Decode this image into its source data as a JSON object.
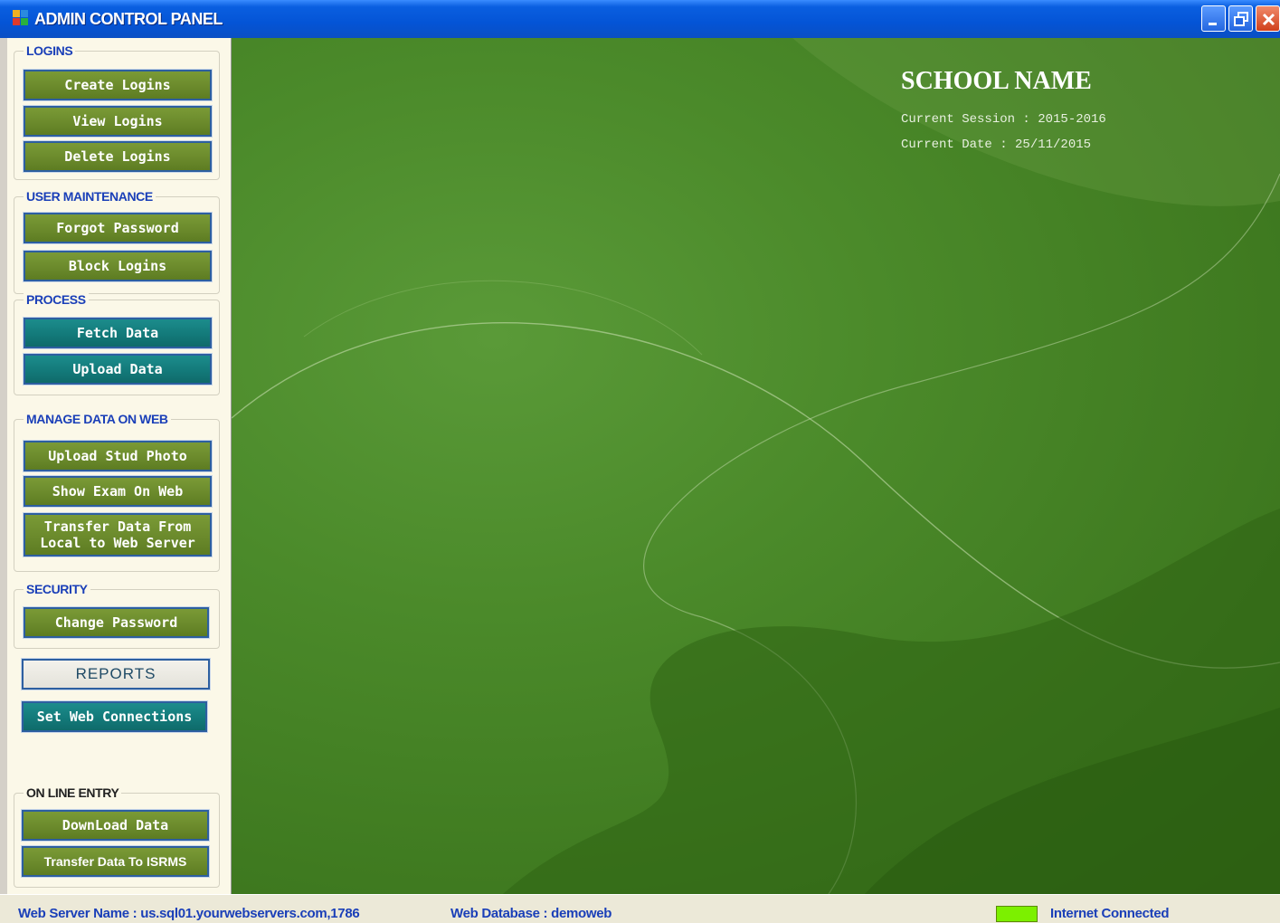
{
  "window": {
    "title": "ADMIN  CONTROL PANEL",
    "title_color": "#0a5fe0"
  },
  "sidebar": {
    "groups": [
      {
        "title": "LOGINS",
        "buttons": [
          "Create Logins",
          "View Logins",
          "Delete Logins"
        ]
      },
      {
        "title": "USER MAINTENANCE",
        "buttons": [
          "Forgot Password",
          "Block Logins"
        ]
      },
      {
        "title": "PROCESS",
        "buttons": [
          "Fetch Data",
          "Upload Data"
        ]
      },
      {
        "title": "MANAGE DATA ON WEB",
        "buttons": [
          "Upload Stud Photo",
          "Show Exam On Web",
          "Transfer Data From Local to Web Server"
        ]
      },
      {
        "title": "SECURITY",
        "buttons": [
          "Change Password"
        ]
      },
      {
        "title": "ON LINE ENTRY",
        "buttons": [
          "DownLoad Data",
          "Transfer Data To ISRMS"
        ]
      }
    ],
    "reports_label": "REPORTS",
    "set_web_connections_label": "Set Web Connections"
  },
  "main": {
    "school_name": "SCHOOL NAME",
    "session_line": "Current Session : 2015-2016",
    "date_line": "Current Date : 25/11/2015"
  },
  "status": {
    "server": "Web Server Name : us.sql01.yourwebservers.com,1786",
    "database": "Web Database : demoweb",
    "internet": "Internet Connected",
    "indicator_color": "#7cf000"
  },
  "colors": {
    "button_green": "#6b8a2c",
    "button_teal": "#137a7a",
    "background_green": "#4b8a2a",
    "sidebar_bg": "#fbf8e8"
  }
}
